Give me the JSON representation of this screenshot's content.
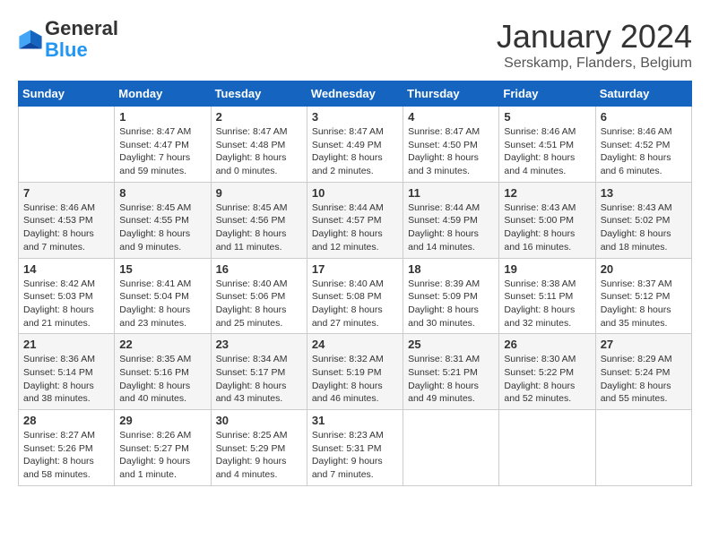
{
  "logo": {
    "general": "General",
    "blue": "Blue"
  },
  "header": {
    "month": "January 2024",
    "location": "Serskamp, Flanders, Belgium"
  },
  "days_of_week": [
    "Sunday",
    "Monday",
    "Tuesday",
    "Wednesday",
    "Thursday",
    "Friday",
    "Saturday"
  ],
  "weeks": [
    [
      {
        "day": "",
        "info": ""
      },
      {
        "day": "1",
        "info": "Sunrise: 8:47 AM\nSunset: 4:47 PM\nDaylight: 7 hours\nand 59 minutes."
      },
      {
        "day": "2",
        "info": "Sunrise: 8:47 AM\nSunset: 4:48 PM\nDaylight: 8 hours\nand 0 minutes."
      },
      {
        "day": "3",
        "info": "Sunrise: 8:47 AM\nSunset: 4:49 PM\nDaylight: 8 hours\nand 2 minutes."
      },
      {
        "day": "4",
        "info": "Sunrise: 8:47 AM\nSunset: 4:50 PM\nDaylight: 8 hours\nand 3 minutes."
      },
      {
        "day": "5",
        "info": "Sunrise: 8:46 AM\nSunset: 4:51 PM\nDaylight: 8 hours\nand 4 minutes."
      },
      {
        "day": "6",
        "info": "Sunrise: 8:46 AM\nSunset: 4:52 PM\nDaylight: 8 hours\nand 6 minutes."
      }
    ],
    [
      {
        "day": "7",
        "info": "Sunrise: 8:46 AM\nSunset: 4:53 PM\nDaylight: 8 hours\nand 7 minutes."
      },
      {
        "day": "8",
        "info": "Sunrise: 8:45 AM\nSunset: 4:55 PM\nDaylight: 8 hours\nand 9 minutes."
      },
      {
        "day": "9",
        "info": "Sunrise: 8:45 AM\nSunset: 4:56 PM\nDaylight: 8 hours\nand 11 minutes."
      },
      {
        "day": "10",
        "info": "Sunrise: 8:44 AM\nSunset: 4:57 PM\nDaylight: 8 hours\nand 12 minutes."
      },
      {
        "day": "11",
        "info": "Sunrise: 8:44 AM\nSunset: 4:59 PM\nDaylight: 8 hours\nand 14 minutes."
      },
      {
        "day": "12",
        "info": "Sunrise: 8:43 AM\nSunset: 5:00 PM\nDaylight: 8 hours\nand 16 minutes."
      },
      {
        "day": "13",
        "info": "Sunrise: 8:43 AM\nSunset: 5:02 PM\nDaylight: 8 hours\nand 18 minutes."
      }
    ],
    [
      {
        "day": "14",
        "info": "Sunrise: 8:42 AM\nSunset: 5:03 PM\nDaylight: 8 hours\nand 21 minutes."
      },
      {
        "day": "15",
        "info": "Sunrise: 8:41 AM\nSunset: 5:04 PM\nDaylight: 8 hours\nand 23 minutes."
      },
      {
        "day": "16",
        "info": "Sunrise: 8:40 AM\nSunset: 5:06 PM\nDaylight: 8 hours\nand 25 minutes."
      },
      {
        "day": "17",
        "info": "Sunrise: 8:40 AM\nSunset: 5:08 PM\nDaylight: 8 hours\nand 27 minutes."
      },
      {
        "day": "18",
        "info": "Sunrise: 8:39 AM\nSunset: 5:09 PM\nDaylight: 8 hours\nand 30 minutes."
      },
      {
        "day": "19",
        "info": "Sunrise: 8:38 AM\nSunset: 5:11 PM\nDaylight: 8 hours\nand 32 minutes."
      },
      {
        "day": "20",
        "info": "Sunrise: 8:37 AM\nSunset: 5:12 PM\nDaylight: 8 hours\nand 35 minutes."
      }
    ],
    [
      {
        "day": "21",
        "info": "Sunrise: 8:36 AM\nSunset: 5:14 PM\nDaylight: 8 hours\nand 38 minutes."
      },
      {
        "day": "22",
        "info": "Sunrise: 8:35 AM\nSunset: 5:16 PM\nDaylight: 8 hours\nand 40 minutes."
      },
      {
        "day": "23",
        "info": "Sunrise: 8:34 AM\nSunset: 5:17 PM\nDaylight: 8 hours\nand 43 minutes."
      },
      {
        "day": "24",
        "info": "Sunrise: 8:32 AM\nSunset: 5:19 PM\nDaylight: 8 hours\nand 46 minutes."
      },
      {
        "day": "25",
        "info": "Sunrise: 8:31 AM\nSunset: 5:21 PM\nDaylight: 8 hours\nand 49 minutes."
      },
      {
        "day": "26",
        "info": "Sunrise: 8:30 AM\nSunset: 5:22 PM\nDaylight: 8 hours\nand 52 minutes."
      },
      {
        "day": "27",
        "info": "Sunrise: 8:29 AM\nSunset: 5:24 PM\nDaylight: 8 hours\nand 55 minutes."
      }
    ],
    [
      {
        "day": "28",
        "info": "Sunrise: 8:27 AM\nSunset: 5:26 PM\nDaylight: 8 hours\nand 58 minutes."
      },
      {
        "day": "29",
        "info": "Sunrise: 8:26 AM\nSunset: 5:27 PM\nDaylight: 9 hours\nand 1 minute."
      },
      {
        "day": "30",
        "info": "Sunrise: 8:25 AM\nSunset: 5:29 PM\nDaylight: 9 hours\nand 4 minutes."
      },
      {
        "day": "31",
        "info": "Sunrise: 8:23 AM\nSunset: 5:31 PM\nDaylight: 9 hours\nand 7 minutes."
      },
      {
        "day": "",
        "info": ""
      },
      {
        "day": "",
        "info": ""
      },
      {
        "day": "",
        "info": ""
      }
    ]
  ]
}
